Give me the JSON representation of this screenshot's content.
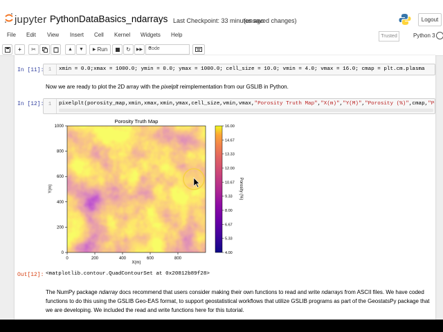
{
  "header": {
    "logo_text": "jupyter",
    "notebook_title": "PythonDataBasics_ndarrays",
    "checkpoint": "Last Checkpoint: 33 minutes ago",
    "unsaved": "(unsaved changes)",
    "logout_label": "Logout"
  },
  "menubar": {
    "items": [
      "File",
      "Edit",
      "View",
      "Insert",
      "Cell",
      "Kernel",
      "Widgets",
      "Help"
    ],
    "trusted_label": "Trusted",
    "kernel_name": "Python 3"
  },
  "toolbar": {
    "run_label": "Run",
    "cell_type": "Code",
    "icons": [
      "save-icon",
      "plus-icon",
      "cut-icon",
      "copy-icon",
      "paste-icon",
      "arrow-up-icon",
      "arrow-down-icon",
      "run-icon",
      "stop-icon",
      "restart-icon",
      "fast-forward-icon",
      "keyboard-icon"
    ]
  },
  "cells": {
    "cell1": {
      "prompt": "In [11]:",
      "line_number": "1",
      "code": "xmin = 0.0;xmax = 1000.0; ymin = 0.0; ymax = 1000.0; cell_size = 10.0; vmin = 4.0; vmax = 16.0; cmap = plt.cm.plasma"
    },
    "markdown1": {
      "before": "Now we are ready to plot the 2D array with the ",
      "emph": "pixelplt",
      "after": " reimplementation from our GSLIB in Python."
    },
    "cell2": {
      "prompt": "In [12]:",
      "line_number": "1",
      "code_pre": "pixelplt(porosity_map,xmin,xmax,xmin,ymax,cell_size,vmin,vmax,",
      "s1": "\"Porosity Truth Map\"",
      "c1": ",",
      "s2": "\"X(m)\"",
      "c2": ",",
      "s3": "\"Y(M)\"",
      "c3": ",",
      "s4": "\"Porosity (%)\"",
      "code_post": ",cmap,",
      "s5": "\"Porosit"
    },
    "output2": {
      "prompt": "Out[12]:",
      "text": "<matplotlib.contour.QuadContourSet at 0x20812b89f28>"
    },
    "markdown2": {
      "line1_a": "The NumPy package ",
      "line1_em1": "ndarray",
      "line1_b": " docs recommend that users consider making their own functions to read and write ",
      "line1_em2": "ndarrays",
      "line1_c": " from ASCII files. We have coded",
      "line2": "functions to do this using the GSLIB Geo-EAS format, to support geostatistical workflows that utilize GSLIB programs as part of the GeostatsPy package that",
      "line3": "we are developing. We included the read and write functions here for this tutorial."
    }
  },
  "chart_data": {
    "type": "heatmap",
    "title": "Porosity Truth Map",
    "xlabel": "X(m)",
    "ylabel": "Y(m)",
    "xlim": [
      0,
      1000
    ],
    "ylim": [
      0,
      1000
    ],
    "x_ticks": [
      "0",
      "200",
      "400",
      "600",
      "800"
    ],
    "y_ticks": [
      "0",
      "200",
      "400",
      "600",
      "800",
      "1000"
    ],
    "colorbar": {
      "label": "Porosity (%)",
      "vmin": 4.0,
      "vmax": 16.0,
      "ticks": [
        "4.00",
        "5.33",
        "6.67",
        "8.00",
        "9.33",
        "10.67",
        "12.00",
        "13.33",
        "14.67",
        "16.00"
      ]
    },
    "colormap": "plasma",
    "colors": {
      "low": "#0d0887",
      "mid": "#cc4778",
      "high": "#f0f921"
    }
  },
  "cursor": {
    "icon": "mouse-pointer-icon",
    "highlight_color": "#ffe066"
  }
}
